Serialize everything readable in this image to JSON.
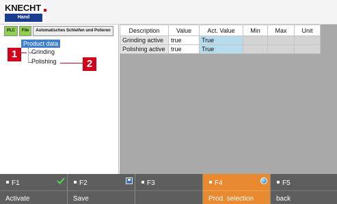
{
  "header": {
    "logo_text": "KNECHT",
    "mode_badge": "Hand"
  },
  "left_tabs": [
    {
      "label": "PLC"
    },
    {
      "label": "File"
    },
    {
      "label": "Automatisches Schleifen und Polieren"
    }
  ],
  "tree": {
    "root": "Product data",
    "children": [
      {
        "label": "Grinding"
      },
      {
        "label": "Polishing"
      }
    ]
  },
  "callouts": [
    "1",
    "2"
  ],
  "table": {
    "columns": [
      "Description",
      "Value",
      "Act. Value",
      "Min",
      "Max",
      "Unit"
    ],
    "rows": [
      {
        "description": "Grinding active",
        "value": "true",
        "act_value": "True",
        "min": "",
        "max": "",
        "unit": ""
      },
      {
        "description": "Polishing active",
        "value": "true",
        "act_value": "True",
        "min": "",
        "max": "",
        "unit": ""
      }
    ]
  },
  "function_keys": [
    {
      "key": "F1",
      "action": "Activate",
      "icon": "check-icon"
    },
    {
      "key": "F2",
      "action": "Save",
      "icon": "save-icon"
    },
    {
      "key": "F3",
      "action": "",
      "icon": ""
    },
    {
      "key": "F4",
      "action": "Prod. selection",
      "icon": "globe-icon",
      "active": true
    },
    {
      "key": "F5",
      "action": "back",
      "icon": ""
    }
  ],
  "colors": {
    "selection": "#3f7fcc",
    "active_key": "#e8892f",
    "callout": "#d0021b",
    "act_value_bg": "#b7dcee"
  }
}
